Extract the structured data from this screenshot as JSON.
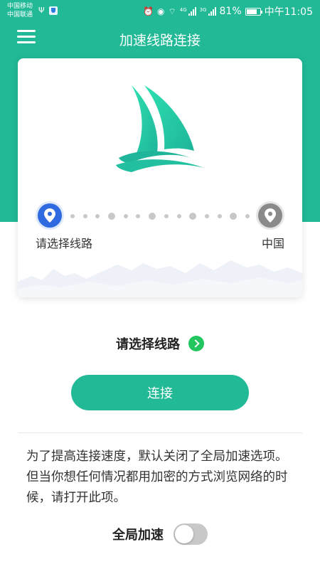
{
  "status_bar": {
    "carrier_1": "中国移动",
    "carrier_2": "中国联通",
    "network_1": "4G",
    "network_2": "3G",
    "battery": "81%",
    "time": "中午11:05"
  },
  "app_bar": {
    "title": "加速线路连接",
    "menu_icon": "hamburger-icon"
  },
  "route": {
    "logo_icon": "sailboat-icon",
    "start_label": "请选择线路",
    "end_label": "中国",
    "start_icon": "location-pin-icon",
    "end_icon": "location-pin-icon"
  },
  "select_route": {
    "label": "请选择线路",
    "icon": "chevron-right-icon"
  },
  "connect_button": "连接",
  "notice": {
    "text": "为了提高连接速度，默认关闭了全局加速选项。但当你想任何情况都用加密的方式浏览网络的时候，请打开此项。"
  },
  "global_accel": {
    "label": "全局加速",
    "enabled": false
  },
  "colors": {
    "primary": "#22b996",
    "start_pin": "#2f6ae0",
    "end_pin": "#8a8a8a",
    "go_icon": "#22c55e"
  }
}
